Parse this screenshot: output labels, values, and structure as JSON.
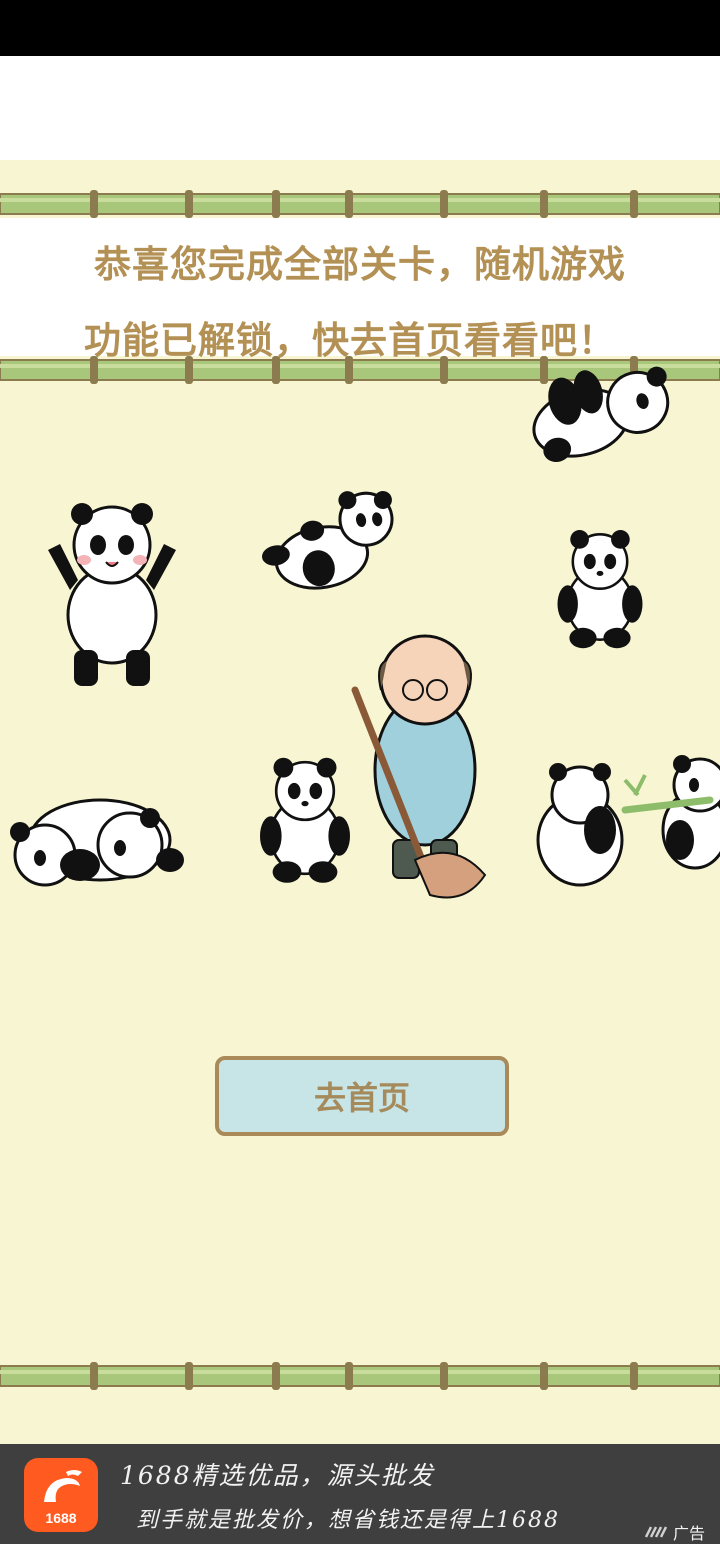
{
  "message": {
    "line1": "恭喜您完成全部关卡，随机游戏",
    "line2": "功能已解锁，快去首页看看吧！"
  },
  "home_button": {
    "label": "去首页"
  },
  "ad": {
    "logo_text": "1688",
    "title": "1688精选优品，源头批发",
    "subtitle": "到手就是批发价，想省钱还是得上1688",
    "badge": "广告",
    "brand_color": "#ff5a1f"
  },
  "colors": {
    "background": "#f8f6d2",
    "title_text": "#b39155",
    "button_fill": "#c7e4e6",
    "button_border": "#a98a58",
    "bamboo": "#a9c77a"
  }
}
